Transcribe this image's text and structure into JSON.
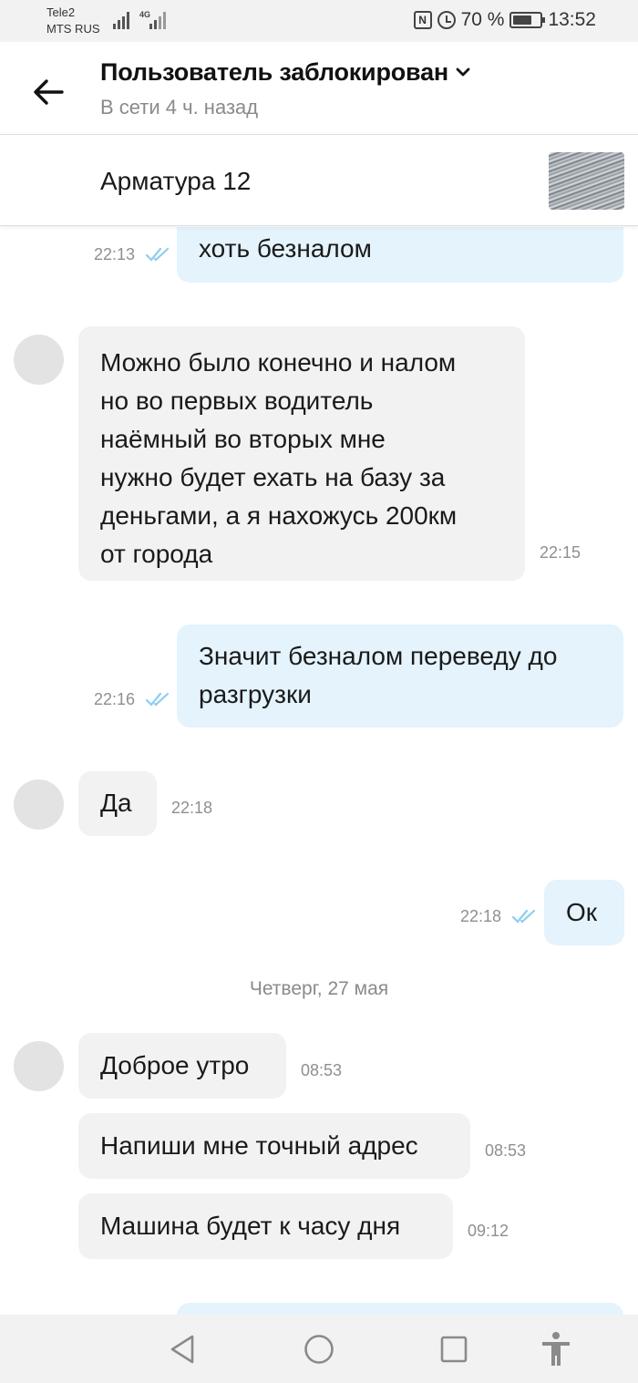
{
  "status_bar": {
    "carrier_1": "Tele2",
    "carrier_2": "MTS RUS",
    "network_type": "4G",
    "battery_percent": "70 %",
    "battery_level": 0.7,
    "time": "13:52",
    "icons": [
      "signal-icon",
      "nfc-icon",
      "alarm-icon",
      "battery-icon"
    ]
  },
  "header": {
    "title": "Пользователь заблокирован",
    "subtitle": "В сети 4 ч. назад",
    "icons": [
      "back-arrow-icon",
      "chevron-down-icon"
    ]
  },
  "listing": {
    "title": "Арматура 12"
  },
  "chat": {
    "date_separator": "Четверг, 27 мая",
    "messages": [
      {
        "id": "m1",
        "direction": "out",
        "text": "хоть безналом",
        "time": "22:13",
        "read": true
      },
      {
        "id": "m2",
        "direction": "in",
        "lines": [
          "Можно было конечно и налом",
          "но во первых водитель",
          "наёмный во вторых мне",
          "нужно будет ехать на базу за",
          "деньгами, а я нахожусь 200км",
          "от города"
        ],
        "time": "22:15"
      },
      {
        "id": "m3",
        "direction": "out",
        "lines": [
          "Значит безналом переведу до",
          "разгрузки"
        ],
        "time": "22:16",
        "read": true
      },
      {
        "id": "m4",
        "direction": "in",
        "text": "Да",
        "time": "22:18"
      },
      {
        "id": "m5",
        "direction": "out",
        "text": "Ок",
        "time": "22:18",
        "read": true
      },
      {
        "id": "m6",
        "direction": "in",
        "text": "Доброе утро",
        "time": "08:53"
      },
      {
        "id": "m7",
        "direction": "in",
        "text": "Напиши мне точный адрес",
        "time": "08:53"
      },
      {
        "id": "m8",
        "direction": "in",
        "text": "Машина будет к часу дня",
        "time": "09:12"
      }
    ]
  },
  "colors": {
    "outgoing_bubble": "#e4f3fc",
    "incoming_bubble": "#f2f2f2",
    "read_ticks": "#8ecdf0",
    "muted_text": "#8a8a8a"
  },
  "navbar": {
    "icons": [
      "back-triangle-icon",
      "home-circle-icon",
      "recents-square-icon",
      "accessibility-icon"
    ]
  }
}
